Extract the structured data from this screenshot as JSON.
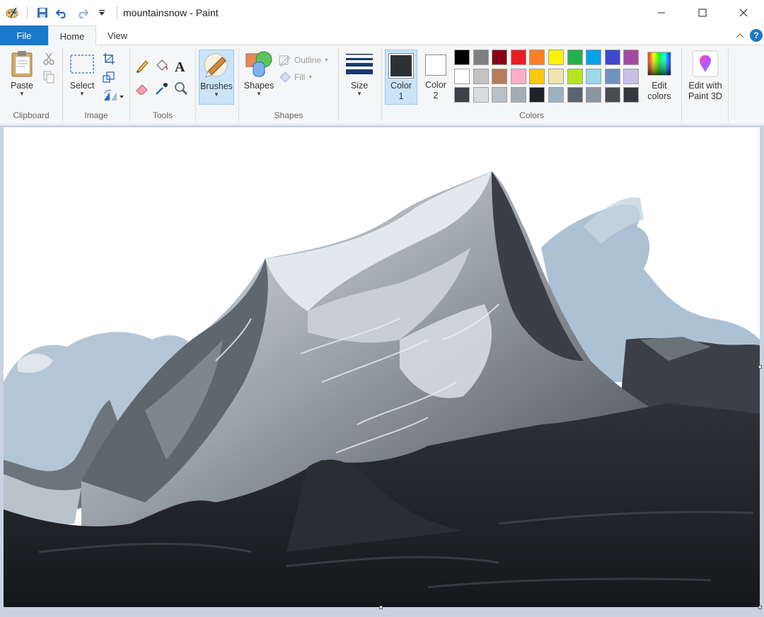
{
  "window": {
    "title": "mountainsnow - Paint",
    "controls": {
      "minimize": "minimize",
      "maximize": "maximize",
      "close": "close"
    }
  },
  "quick_access": [
    "paint-icon",
    "save-icon",
    "undo-icon",
    "redo-icon",
    "customize-dropdown-icon"
  ],
  "tabs": {
    "file": "File",
    "home": "Home",
    "view": "View",
    "help": "?"
  },
  "ribbon": {
    "clipboard": {
      "paste": "Paste",
      "group": "Clipboard"
    },
    "image": {
      "select": "Select",
      "group": "Image"
    },
    "tools": {
      "group": "Tools"
    },
    "brushes": {
      "label": "Brushes"
    },
    "shapes": {
      "shapes": "Shapes",
      "outline": "Outline",
      "fill": "Fill",
      "group": "Shapes"
    },
    "size": {
      "label": "Size"
    },
    "colors": {
      "color1_line1": "Color",
      "color1_line2": "1",
      "color2_line1": "Color",
      "color2_line2": "2",
      "edit_colors_line1": "Edit",
      "edit_colors_line2": "colors",
      "group": "Colors",
      "color1_value": "#2d3136",
      "color2_value": "#ffffff",
      "palette": [
        "#000000",
        "#7f7f7f",
        "#880015",
        "#ed1c24",
        "#ff7f27",
        "#fff200",
        "#22b14c",
        "#00a2e8",
        "#3f48cc",
        "#a349a4",
        "#ffffff",
        "#c3c3c3",
        "#b97a57",
        "#ffaec9",
        "#ffc90e",
        "#efe4b0",
        "#b5e61d",
        "#99d9ea",
        "#7092be",
        "#c8bfe7",
        "#3c4046",
        "#d9dcde",
        "#b8c0c8",
        "#a4adb5",
        "#1f2226",
        "#9cb0c4",
        "#5a6470",
        "#8c96a0",
        "#474c52",
        "#353a40"
      ]
    },
    "paint3d": {
      "line1": "Edit with",
      "line2": "Paint 3D"
    }
  },
  "canvas": {
    "image": "mountain-snow-painting"
  }
}
